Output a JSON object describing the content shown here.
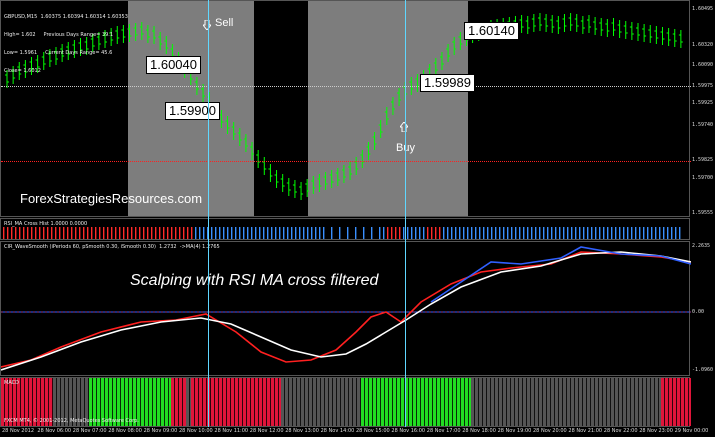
{
  "header": {
    "symbol_line": "GBPUSD,M15  1.60375 1.60394 1.60314 1.60353",
    "high_line": "High= 1.602     Previous Days Range= 39.1",
    "low_line": "Low= 1.5961     Current Days Range= 45.6",
    "close_line": "Close= 1.6012"
  },
  "price_axis": {
    "ticks": [
      "1.60495",
      "1.60320",
      "1.60090",
      "1.59975",
      "1.59925",
      "1.59740",
      "1.59825",
      "1.59700",
      "1.59555"
    ]
  },
  "labels": {
    "box1": "1.60040",
    "box2": "1.59900",
    "box3": "1.60140",
    "box4": "1.59989",
    "sell": "Sell",
    "buy": "Buy",
    "watermark": "ForexStrategiesResources.com",
    "title": "Scalping with RSI MA cross filtered"
  },
  "panes": {
    "rsi_ma": "RSI_MA Cross Hist 1.0000 0.0000",
    "wave": "CIR_WaveSmooth (iPeriods 60, pSmooth 0.30, iSmooth 0.30)  1.2732  ->MA(4) 1.2765",
    "macd": "MACD",
    "wave_axis": [
      "2.2635",
      "0.00",
      "-1.0960"
    ]
  },
  "footer": {
    "left": "FXCM MT4, © 2001-2012, MetaQuotes Software Corp."
  },
  "time_axis": {
    "labels": [
      "28 Nov 2012",
      "28 Nov 06:00",
      "28 Nov 07:00",
      "28 Nov 08:00",
      "28 Nov 09:00",
      "28 Nov 10:00",
      "28 Nov 11:00",
      "28 Nov 12:00",
      "28 Nov 13:00",
      "28 Nov 14:00",
      "28 Nov 15:00",
      "28 Nov 16:00",
      "28 Nov 17:00",
      "28 Nov 18:00",
      "28 Nov 19:00",
      "28 Nov 20:00",
      "28 Nov 21:00",
      "28 Nov 22:00",
      "28 Nov 23:00",
      "29 Nov 00:00"
    ]
  },
  "colors": {
    "candle": "#00ff00",
    "session_shade": "#808080",
    "cursor": "#5fd7ff",
    "red_line": "#ff2020",
    "blue_line": "#3060ff"
  }
}
